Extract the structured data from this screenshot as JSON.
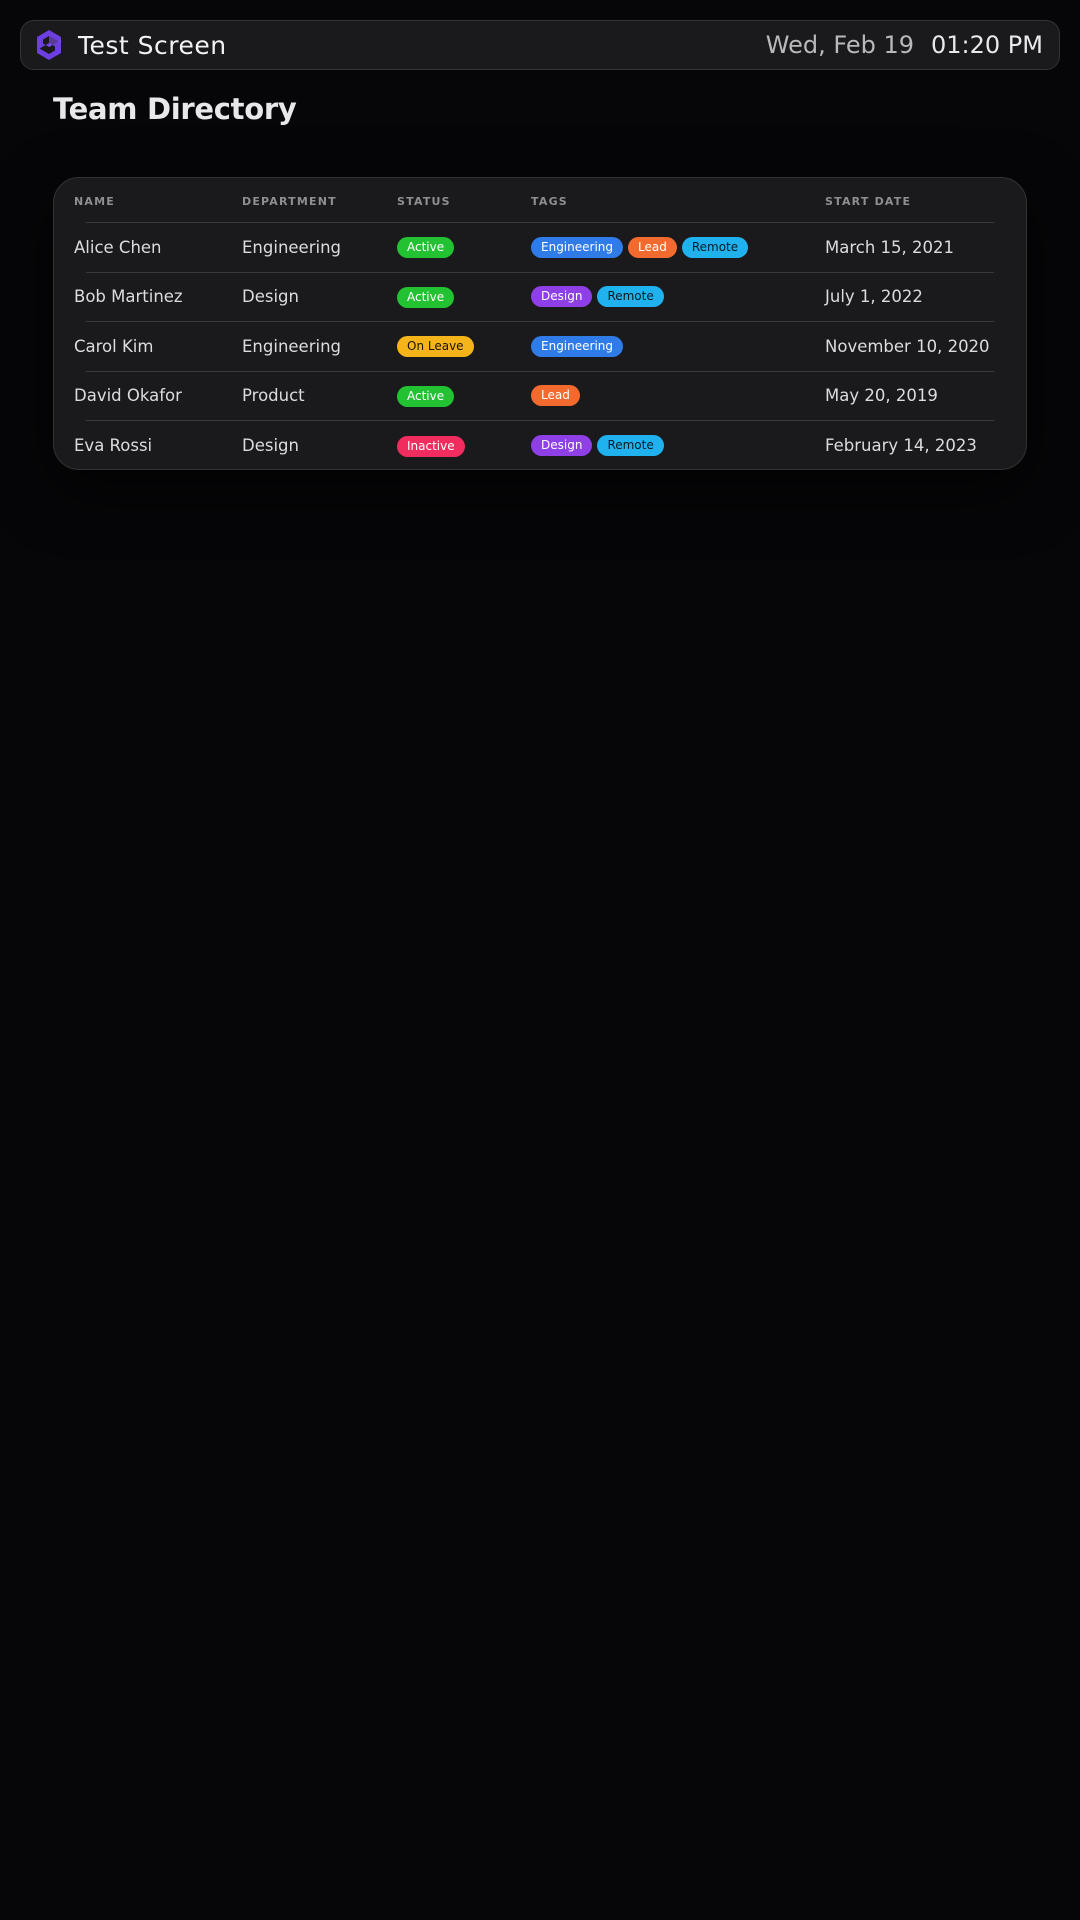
{
  "header": {
    "app_title": "Test Screen",
    "date": "Wed, Feb 19",
    "time": "01:20 PM",
    "logo_icon": "hexagon-s-logo-icon",
    "logo_color": "#6d3fe0"
  },
  "page": {
    "title": "Team Directory"
  },
  "table": {
    "columns": [
      "NAME",
      "DEPARTMENT",
      "STATUS",
      "TAGS",
      "START DATE"
    ],
    "rows": [
      {
        "name": "Alice Chen",
        "department": "Engineering",
        "status": {
          "label": "Active",
          "bg": "#22c232",
          "fg": "#ffffff"
        },
        "tags": [
          {
            "label": "Engineering",
            "bg": "#2f7be8",
            "fg": "#ffffff"
          },
          {
            "label": "Lead",
            "bg": "#f26a2e",
            "fg": "#ffffff"
          },
          {
            "label": "Remote",
            "bg": "#1fb2ee",
            "fg": "#0b1a24"
          }
        ],
        "start_date": "March 15, 2021"
      },
      {
        "name": "Bob Martinez",
        "department": "Design",
        "status": {
          "label": "Active",
          "bg": "#22c232",
          "fg": "#ffffff"
        },
        "tags": [
          {
            "label": "Design",
            "bg": "#8e3fe6",
            "fg": "#ffffff"
          },
          {
            "label": "Remote",
            "bg": "#1fb2ee",
            "fg": "#0b1a24"
          }
        ],
        "start_date": "July 1, 2022"
      },
      {
        "name": "Carol Kim",
        "department": "Engineering",
        "status": {
          "label": "On Leave",
          "bg": "#f5b51a",
          "fg": "#1a1405"
        },
        "tags": [
          {
            "label": "Engineering",
            "bg": "#2f7be8",
            "fg": "#ffffff"
          }
        ],
        "start_date": "November 10, 2020"
      },
      {
        "name": "David Okafor",
        "department": "Product",
        "status": {
          "label": "Active",
          "bg": "#22c232",
          "fg": "#ffffff"
        },
        "tags": [
          {
            "label": "Lead",
            "bg": "#f26a2e",
            "fg": "#ffffff"
          }
        ],
        "start_date": "May 20, 2019"
      },
      {
        "name": "Eva Rossi",
        "department": "Design",
        "status": {
          "label": "Inactive",
          "bg": "#f02d5e",
          "fg": "#ffffff"
        },
        "tags": [
          {
            "label": "Design",
            "bg": "#8e3fe6",
            "fg": "#ffffff"
          },
          {
            "label": "Remote",
            "bg": "#1fb2ee",
            "fg": "#0b1a24"
          }
        ],
        "start_date": "February 14, 2023"
      }
    ]
  }
}
